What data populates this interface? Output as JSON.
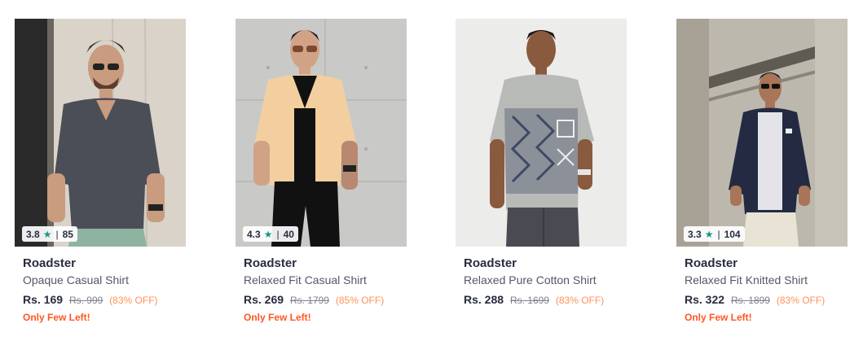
{
  "products": [
    {
      "rating": "3.8",
      "reviews": "85",
      "brand": "Roadster",
      "title": "Opaque Casual Shirt",
      "price": "Rs. 169",
      "mrp": "Rs. 999",
      "discount": "(83% OFF)",
      "stock": "Only Few Left!",
      "shirt_color": "#4b4d57",
      "bg_color": "#d8d2c8"
    },
    {
      "rating": "4.3",
      "reviews": "40",
      "brand": "Roadster",
      "title": "Relaxed Fit Casual Shirt",
      "price": "Rs. 269",
      "mrp": "Rs. 1799",
      "discount": "(85% OFF)",
      "stock": "Only Few Left!",
      "shirt_color": "#f3cfa0",
      "bg_color": "#c9c9c7"
    },
    {
      "rating": "",
      "reviews": "",
      "brand": "Roadster",
      "title": "Relaxed Pure Cotton Shirt",
      "price": "Rs. 288",
      "mrp": "Rs. 1699",
      "discount": "(83% OFF)",
      "stock": "",
      "shirt_color": "#b8bab8",
      "bg_color": "#ececea"
    },
    {
      "rating": "3.3",
      "reviews": "104",
      "brand": "Roadster",
      "title": "Relaxed Fit Knitted Shirt",
      "price": "Rs. 322",
      "mrp": "Rs. 1899",
      "discount": "(83% OFF)",
      "stock": "Only Few Left!",
      "shirt_color": "#232a42",
      "bg_color": "#bdb8ae"
    }
  ]
}
